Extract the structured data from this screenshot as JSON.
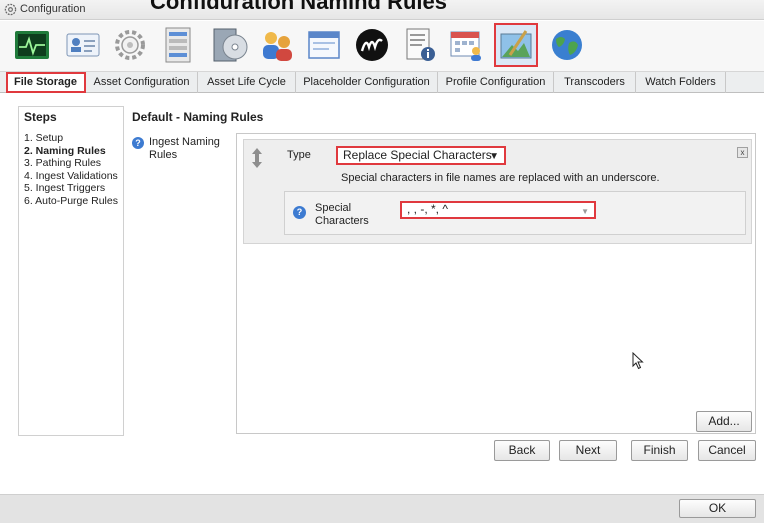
{
  "window": {
    "title": "Configuration",
    "header_overflow_text": "Configuration Naming Rules"
  },
  "toolbar_icons": [
    "monitor-icon",
    "user-card-icon",
    "gear-icon",
    "server-icon",
    "media-disc-icon",
    "users-icon",
    "window-icon",
    "brand-logo-icon",
    "document-info-icon",
    "calendar-user-icon",
    "storage-image-icon",
    "globe-icon"
  ],
  "toolbar_selected": "storage-image-icon",
  "tabs": [
    {
      "label": "File Storage",
      "active": true
    },
    {
      "label": "Asset Configuration",
      "active": false
    },
    {
      "label": "Asset Life Cycle",
      "active": false
    },
    {
      "label": "Placeholder Configuration",
      "active": false
    },
    {
      "label": "Profile Configuration",
      "active": false
    },
    {
      "label": "Transcoders",
      "active": false
    },
    {
      "label": "Watch Folders",
      "active": false
    }
  ],
  "steps": {
    "title": "Steps",
    "items": [
      "1. Setup",
      "2. Naming Rules",
      "3. Pathing Rules",
      "4. Ingest Validations",
      "5. Ingest Triggers",
      "6. Auto-Purge Rules"
    ],
    "current_index": 1
  },
  "section": {
    "title": "Default - Naming Rules",
    "ingest_label_line1": "Ingest Naming",
    "ingest_label_line2": "Rules"
  },
  "rule": {
    "type_label": "Type",
    "type_value": "Replace Special Characters",
    "description": "Special characters in file names are replaced with an underscore.",
    "special_label_line1": "Special",
    "special_label_line2": "Characters",
    "special_value": ", , -, *, ^",
    "close_glyph": "x"
  },
  "buttons": {
    "add": "Add...",
    "back": "Back",
    "next": "Next",
    "finish": "Finish",
    "cancel": "Cancel",
    "ok": "OK"
  },
  "colors": {
    "highlight": "#e0393e",
    "help_blue": "#3d7bd1"
  }
}
